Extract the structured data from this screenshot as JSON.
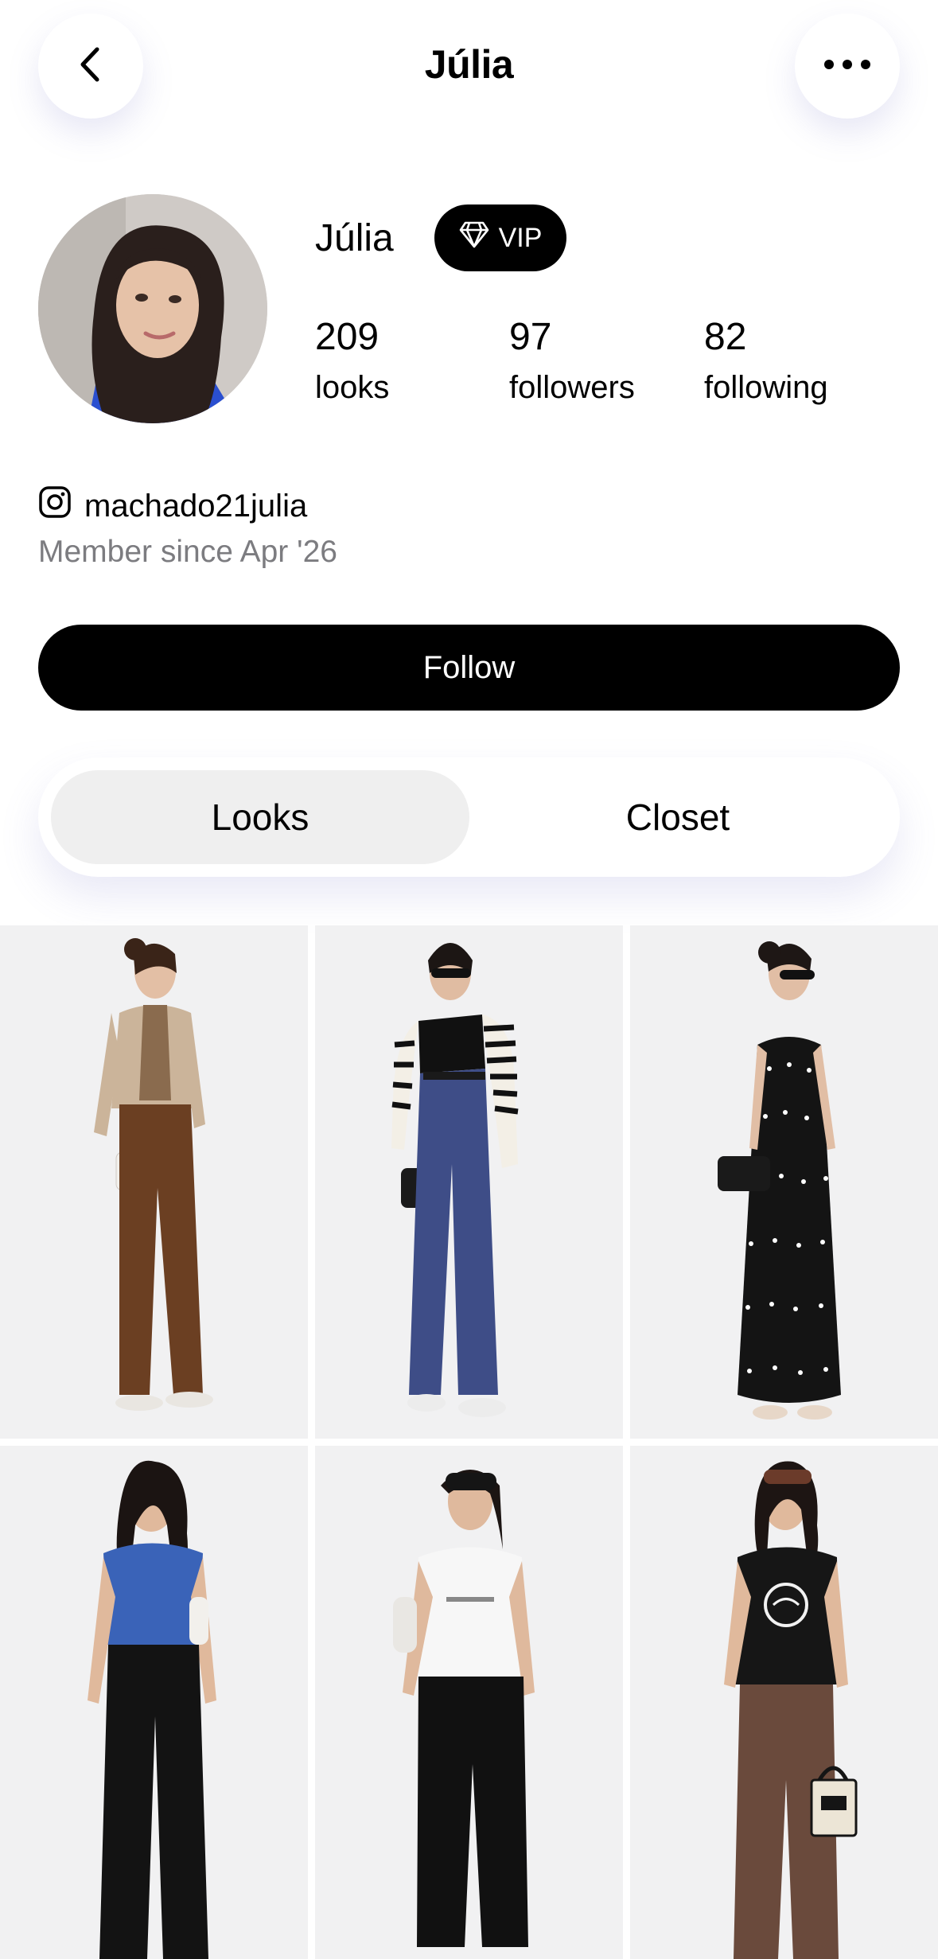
{
  "header": {
    "title": "Júlia"
  },
  "profile": {
    "name": "Júlia",
    "badge": "VIP",
    "stats": {
      "looks": {
        "value": "209",
        "label": "looks"
      },
      "followers": {
        "value": "97",
        "label": "followers"
      },
      "following": {
        "value": "82",
        "label": "following"
      }
    },
    "instagram": "machado21julia",
    "member_since": "Member since Apr '26"
  },
  "actions": {
    "follow_label": "Follow"
  },
  "tabs": [
    {
      "label": "Looks",
      "selected": true
    },
    {
      "label": "Closet",
      "selected": false
    }
  ],
  "looks_grid": [
    {
      "outfit": "beige cardigan, striped shirt, brown trousers, white bag"
    },
    {
      "outfit": "black crop top, striped cardigan, navy trousers"
    },
    {
      "outfit": "black polka dot slip dress"
    },
    {
      "outfit": "blue top, black wide pants"
    },
    {
      "outfit": "white tee, black joggers"
    },
    {
      "outfit": "black graphic tee, brown pants, kate spade tote"
    }
  ],
  "colors": {
    "accent": "#000000",
    "muted_text": "#7c7c80",
    "tab_selected_bg": "#efefef"
  }
}
